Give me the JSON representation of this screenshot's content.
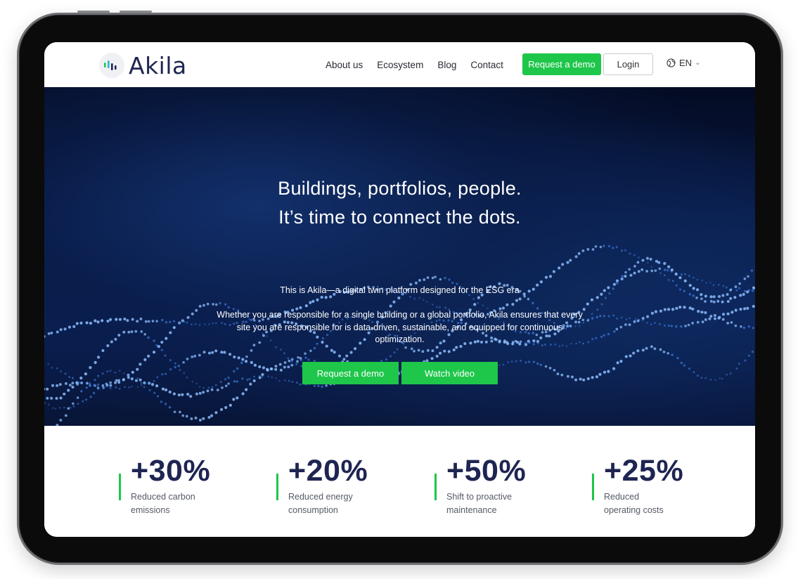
{
  "brand": {
    "name": "Akila",
    "color": "#1f2552",
    "accent": "#1ec64a"
  },
  "nav": {
    "links": [
      "About us",
      "Ecosystem",
      "Blog",
      "Contact"
    ],
    "demo_label": "Request a demo",
    "login_label": "Login",
    "language": "EN",
    "language_icon": "globe-icon"
  },
  "hero": {
    "title_line1": "Buildings, portfolios, people.",
    "title_line2": "It’s time to connect the dots.",
    "tagline": "This is Akila—a digital twin platform designed for the ESG era",
    "description": "Whether you are responsible for a single building or a global portfolio, Akila ensures that every site you are responsible for is data-driven, sustainable, and equipped for continuous optimization.",
    "demo_label": "Request a demo",
    "video_label": "Watch video"
  },
  "stats": [
    {
      "value": "+30%",
      "label": "Reduced carbon emissions"
    },
    {
      "value": "+20%",
      "label": "Reduced energy consumption"
    },
    {
      "value": "+50%",
      "label": "Shift to proactive maintenance"
    },
    {
      "value": "+25%",
      "label": "Reduced operating costs"
    }
  ]
}
